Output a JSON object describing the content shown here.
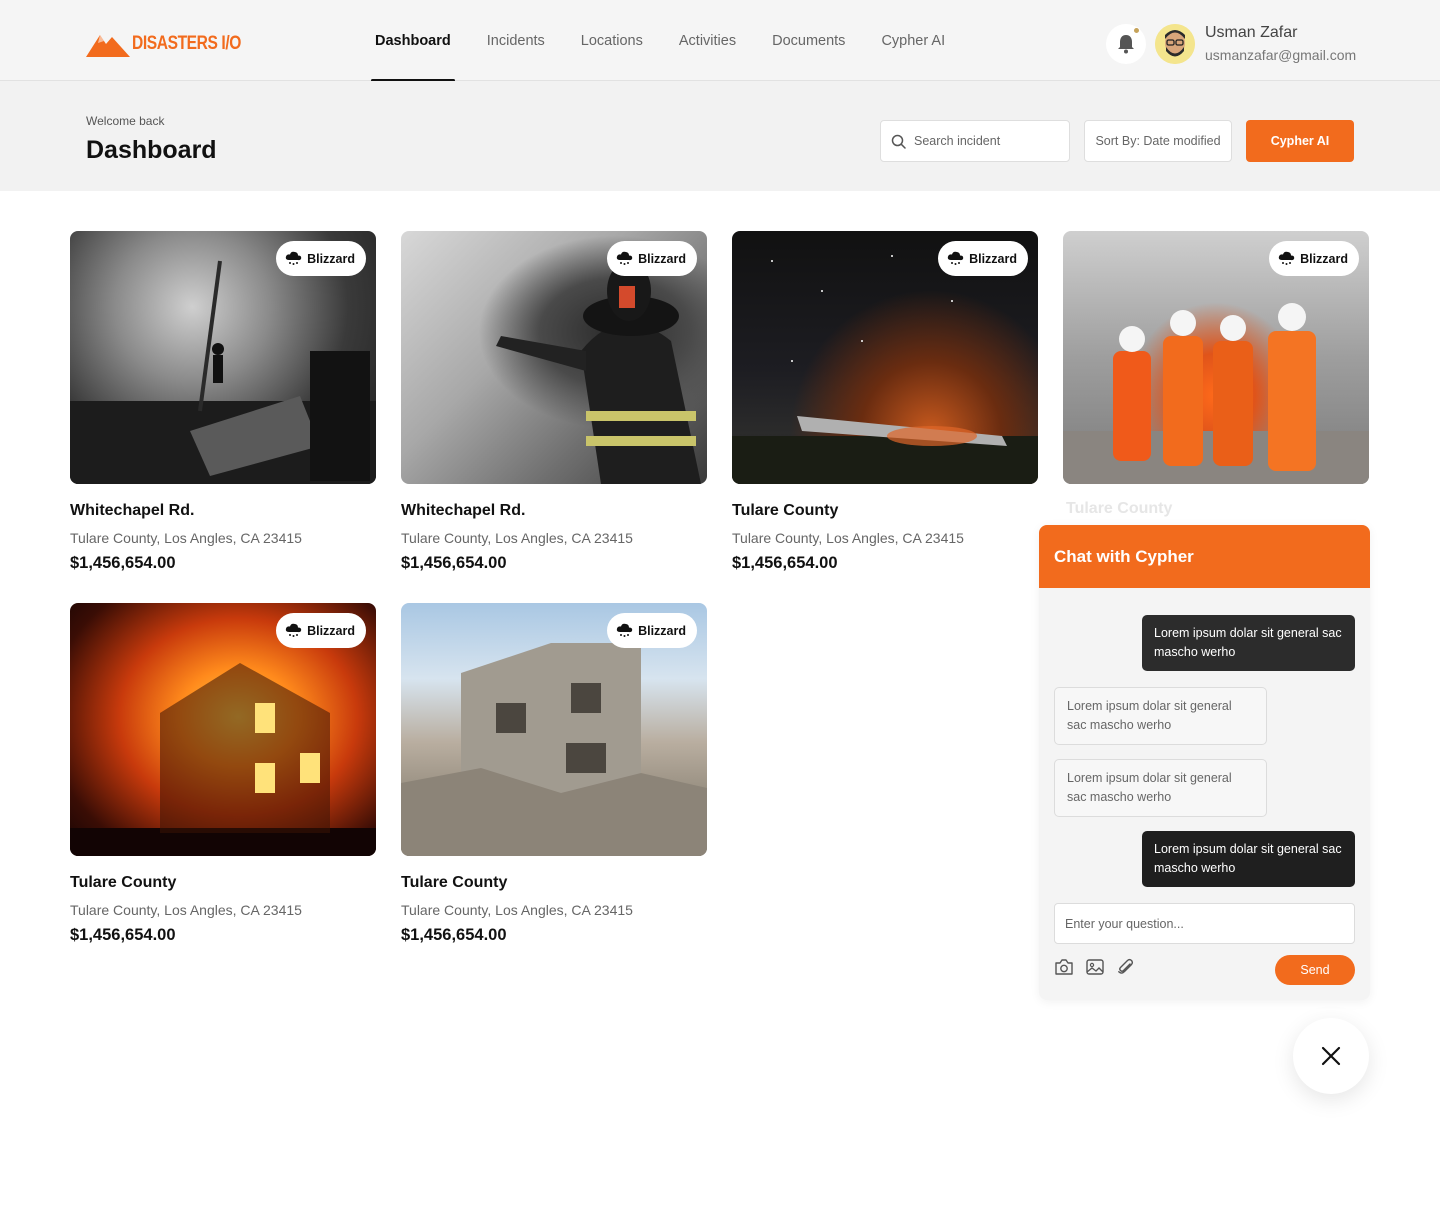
{
  "brand": {
    "name": "DISASTERS I/O",
    "accent": "#f26b1d"
  },
  "nav": {
    "items": [
      {
        "label": "Dashboard",
        "active": true
      },
      {
        "label": "Incidents",
        "active": false
      },
      {
        "label": "Locations",
        "active": false
      },
      {
        "label": "Activities",
        "active": false
      },
      {
        "label": "Documents",
        "active": false
      },
      {
        "label": "Cypher AI",
        "active": false
      }
    ]
  },
  "user": {
    "name": "Usman Zafar",
    "email": "usmanzafar@gmail.com",
    "has_notification": true
  },
  "page": {
    "welcome": "Welcome back",
    "title": "Dashboard",
    "search_placeholder": "Search incident",
    "sort_label": "Sort By: Date modified",
    "cta_label": "Cypher AI"
  },
  "cards": [
    {
      "badge": "Blizzard",
      "title": "Whitechapel Rd.",
      "address": "Tulare County,  Los Angles, CA 23415",
      "price": "$1,456,654.00",
      "image": "smoke-ruins"
    },
    {
      "badge": "Blizzard",
      "title": "Whitechapel Rd.",
      "address": "Tulare County,  Los Angles, CA 23415",
      "price": "$1,456,654.00",
      "image": "firefighter"
    },
    {
      "badge": "Blizzard",
      "title": "Tulare County",
      "address": "Tulare County,  Los Angles, CA 23415",
      "price": "$1,456,654.00",
      "image": "plane-crash-night"
    },
    {
      "badge": "Blizzard",
      "title": "Tulare County",
      "address": "",
      "price": "",
      "image": "rescue-team"
    },
    {
      "badge": "Blizzard",
      "title": "Tulare County",
      "address": "Tulare County,  Los Angles, CA 23415",
      "price": "$1,456,654.00",
      "image": "house-fire"
    },
    {
      "badge": "Blizzard",
      "title": "Tulare County",
      "address": "Tulare County,  Los Angles, CA 23415",
      "price": "$1,456,654.00",
      "image": "collapsed-building"
    }
  ],
  "chat": {
    "title": "Chat with Cypher",
    "messages": [
      {
        "from": "user",
        "text": "Lorem ipsum dolar sit general sac mascho werho"
      },
      {
        "from": "bot",
        "text": "Lorem ipsum dolar sit general sac mascho werho"
      },
      {
        "from": "bot",
        "text": "Lorem ipsum dolar sit general sac mascho werho"
      },
      {
        "from": "user",
        "text": "Lorem ipsum dolar sit general sac mascho werho"
      }
    ],
    "input_placeholder": "Enter your question...",
    "send_label": "Send",
    "tools": [
      "camera-icon",
      "image-icon",
      "paperclip-icon"
    ]
  }
}
